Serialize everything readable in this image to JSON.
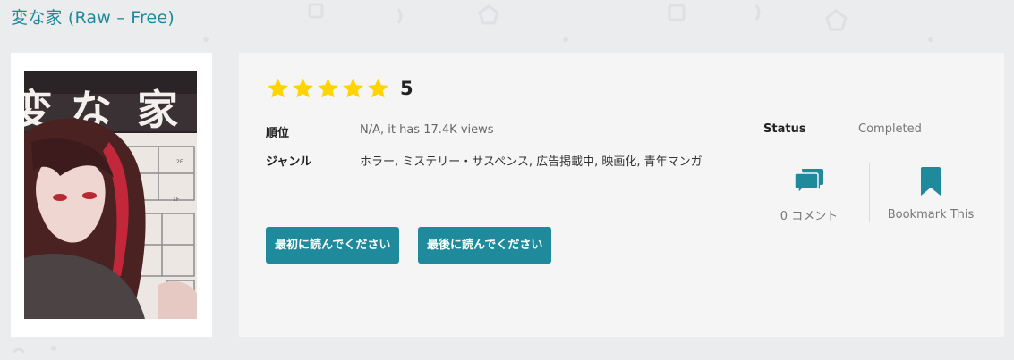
{
  "page": {
    "title": "変な家 (Raw – Free)"
  },
  "cover": {
    "alt": "変な家"
  },
  "rating": {
    "stars_filled": 5,
    "stars_total": 5,
    "value": "5",
    "star_color": "#ffd400"
  },
  "info": {
    "rank_label": "順位",
    "rank_value": "N/A, it has 17.4K views",
    "genre_label": "ジャンル",
    "genres": "ホラー,  ミステリー・サスペンス,  広告掲載中,  映画化,  青年マンガ",
    "status_label": "Status",
    "status_value": "Completed"
  },
  "buttons": {
    "read_first": "最初に読んでください",
    "read_last": "最後に読んでください"
  },
  "actions": {
    "comments_label": "0 コメント",
    "comments_icon": "comments-icon",
    "bookmark_label": "Bookmark This",
    "bookmark_icon": "bookmark-icon"
  },
  "colors": {
    "accent": "#1f8a9b",
    "background": "#ebecee",
    "panel": "#f5f5f5"
  }
}
